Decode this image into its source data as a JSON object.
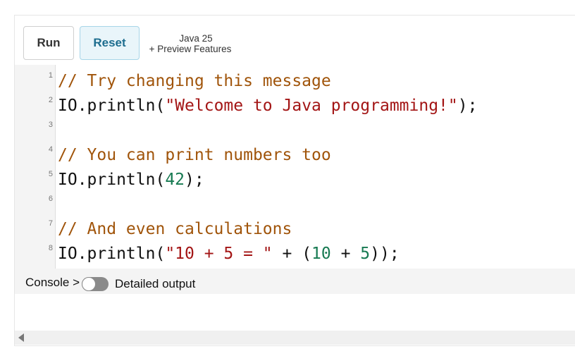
{
  "toolbar": {
    "run_label": "Run",
    "reset_label": "Reset",
    "version_line1": "Java 25",
    "version_line2": "+ Preview Features"
  },
  "editor": {
    "line_numbers": [
      "1",
      "2",
      "3",
      "4",
      "5",
      "6",
      "7",
      "8"
    ],
    "lines": [
      [
        {
          "t": "// Try changing this message",
          "c": "com"
        }
      ],
      [
        {
          "t": "IO.println(",
          "c": "plain"
        },
        {
          "t": "\"Welcome to Java programming!\"",
          "c": "str"
        },
        {
          "t": ");",
          "c": "plain"
        }
      ],
      [],
      [
        {
          "t": "// You can print numbers too",
          "c": "com"
        }
      ],
      [
        {
          "t": "IO.println(",
          "c": "plain"
        },
        {
          "t": "42",
          "c": "num"
        },
        {
          "t": ");",
          "c": "plain"
        }
      ],
      [],
      [
        {
          "t": "// And even calculations",
          "c": "com"
        }
      ],
      [
        {
          "t": "IO.println(",
          "c": "plain"
        },
        {
          "t": "\"10 + 5 = \"",
          "c": "str"
        },
        {
          "t": " + (",
          "c": "plain"
        },
        {
          "t": "10",
          "c": "num"
        },
        {
          "t": " + ",
          "c": "plain"
        },
        {
          "t": "5",
          "c": "num"
        },
        {
          "t": "));",
          "c": "plain"
        }
      ]
    ]
  },
  "console": {
    "label": "Console >",
    "detailed_output_label": "Detailed output",
    "detailed_output_on": false
  },
  "colors": {
    "comment": "#a0540a",
    "string": "#a31515",
    "number": "#177a52",
    "reset_accent": "#1d6d8f"
  }
}
